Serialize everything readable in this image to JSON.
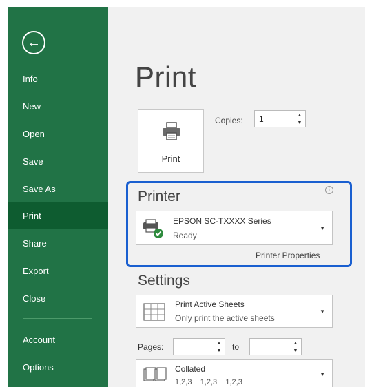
{
  "sidebar": {
    "back_icon": "arrow-left-circle-icon",
    "items": [
      {
        "label": "Info"
      },
      {
        "label": "New"
      },
      {
        "label": "Open"
      },
      {
        "label": "Save"
      },
      {
        "label": "Save As"
      },
      {
        "label": "Print",
        "active": true
      },
      {
        "label": "Share"
      },
      {
        "label": "Export"
      },
      {
        "label": "Close"
      },
      {
        "label": "Account"
      },
      {
        "label": "Options"
      }
    ]
  },
  "main": {
    "title": "Print",
    "print_button_label": "Print",
    "copies_label": "Copies:",
    "copies_value": "1",
    "printer_section_title": "Printer",
    "printer_name": "EPSON SC-TXXXX Series",
    "printer_status": "Ready",
    "printer_properties_link": "Printer Properties",
    "settings_section_title": "Settings",
    "print_what_title": "Print Active Sheets",
    "print_what_sub": "Only print the active sheets",
    "pages_label": "Pages:",
    "to_label": "to",
    "collation_title": "Collated",
    "collation_sub": "1,2,3    1,2,3    1,2,3"
  },
  "colors": {
    "sidebar_bg": "#217346",
    "sidebar_active": "#0e5c30",
    "highlight": "#1a5fd0"
  }
}
